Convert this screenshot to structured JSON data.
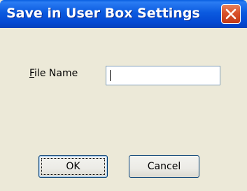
{
  "window": {
    "title": "Save in User Box Settings"
  },
  "form": {
    "file_name_label_accel": "F",
    "file_name_label_rest": "ile Name",
    "file_name_value": ""
  },
  "buttons": {
    "ok_label": "OK",
    "cancel_label": "Cancel"
  },
  "icons": {
    "close": "close-icon"
  }
}
